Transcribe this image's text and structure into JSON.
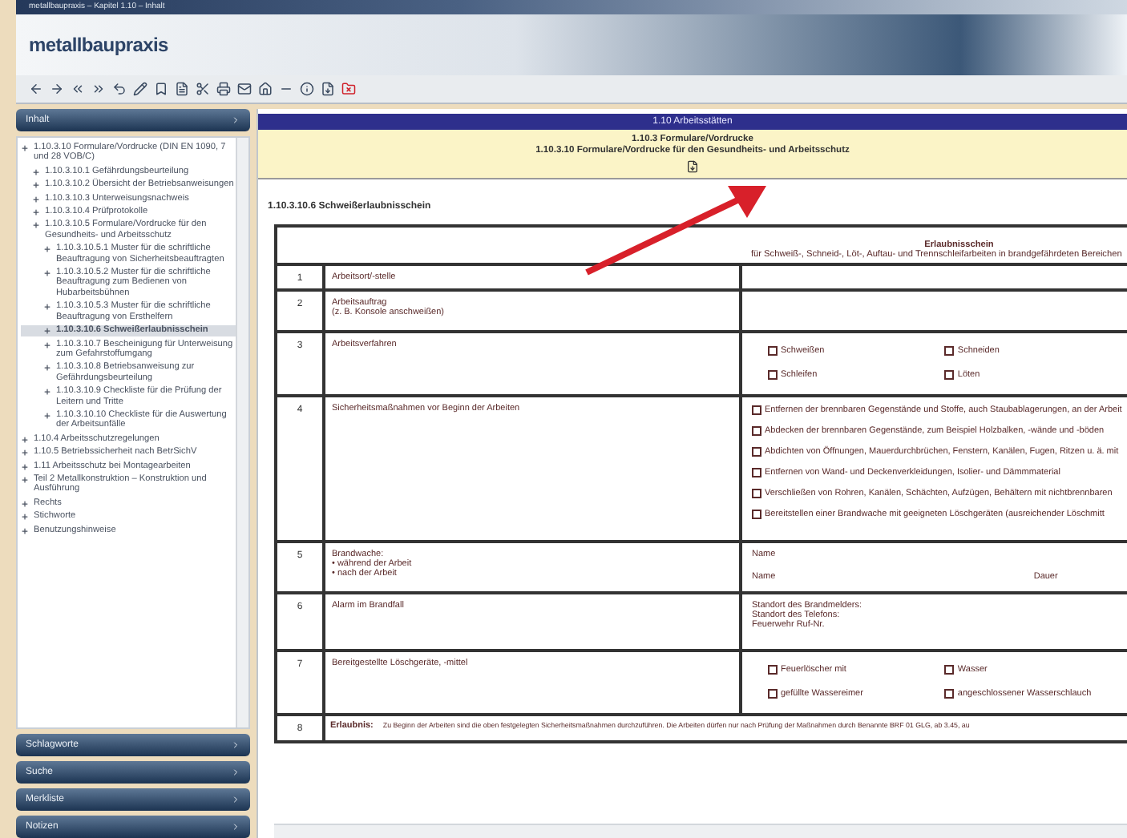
{
  "window": {
    "title": "metallbaupraxis – Kapitel 1.10 – Inhalt"
  },
  "app": {
    "logo": "metallbaupraxis"
  },
  "sidebar": {
    "header": "Inhalt",
    "tree": [
      {
        "label": "1.10.3.10 Formulare/Vordrucke (DIN EN 1090, 7 und 28 VOB/C)",
        "selected": false,
        "children": [
          {
            "label": "1.10.3.10.1 Gefährdungsbeurteilung",
            "selected": false
          },
          {
            "label": "1.10.3.10.2 Übersicht der Betriebsanweisungen",
            "selected": false
          },
          {
            "label": "1.10.3.10.3 Unterweisungsnachweis",
            "selected": false
          },
          {
            "label": "1.10.3.10.4 Prüfprotokolle",
            "selected": false
          },
          {
            "label": "1.10.3.10.5 Formulare/Vordrucke für den Gesundheits- und Arbeitsschutz",
            "selected": false,
            "children": [
              {
                "label": "1.10.3.10.5.1 Muster für die schriftliche Beauftragung von Sicherheitsbeauftragten",
                "selected": false
              },
              {
                "label": "1.10.3.10.5.2 Muster für die schriftliche Beauftragung zum Bedienen von Hubarbeitsbühnen",
                "selected": false
              },
              {
                "label": "1.10.3.10.5.3 Muster für die schriftliche Beauftragung von Ersthelfern",
                "selected": false
              },
              {
                "label": "1.10.3.10.6 Schweißerlaubnisschein",
                "selected": true
              },
              {
                "label": "1.10.3.10.7 Bescheinigung für Unterweisung zum Gefahrstoffumgang",
                "selected": false
              },
              {
                "label": "1.10.3.10.8 Betriebsanweisung zur Gefährdungsbeurteilung",
                "selected": false
              },
              {
                "label": "1.10.3.10.9 Checkliste für die Prüfung der Leitern und Tritte",
                "selected": false
              },
              {
                "label": "1.10.3.10.10 Checkliste für die Auswertung der Arbeitsunfälle",
                "selected": false
              }
            ]
          }
        ]
      },
      {
        "label": "1.10.4 Arbeitsschutzregelungen",
        "selected": false
      },
      {
        "label": "1.10.5 Betriebssicherheit nach BetrSichV",
        "selected": false
      },
      {
        "label": "1.11 Arbeitsschutz bei Montagearbeiten",
        "selected": false
      },
      {
        "label": "Teil 2 Metallkonstruktion – Konstruktion und Ausführung",
        "selected": false
      },
      {
        "label": "Rechts",
        "selected": false
      },
      {
        "label": "Stichworte",
        "selected": false
      },
      {
        "label": "Benutzungshinweise",
        "selected": false
      }
    ],
    "panels": [
      "Schlagworte",
      "Suche",
      "Merkliste",
      "Notizen"
    ]
  },
  "document": {
    "chapter": "1.10 Arbeitsstätten",
    "section": "1.10.3 Formulare/Vordrucke",
    "subsection": "1.10.3.10 Formulare/Vordrucke für den Gesundheits- und Arbeitsschutz",
    "heading": "1.10.3.10.6 Schweißerlaubnisschein",
    "form_title": "Erlaubnisschein",
    "form_subtitle": "für Schweiß-, Schneid-, Löt-, Auftau- und Trennschleifarbeiten in brandgefährdeten Bereichen",
    "rows": [
      {
        "number": "1",
        "label": [
          "Arbeitsort/-stelle"
        ],
        "kind": "blank"
      },
      {
        "number": "2",
        "label": [
          "Arbeitsauftrag",
          "(z. B. Konsole anschweißen)"
        ],
        "kind": "blank"
      },
      {
        "number": "3",
        "label": [
          "Arbeitsverfahren"
        ],
        "kind": "options",
        "options": [
          {
            "text": "Schweißen",
            "checked": false
          },
          {
            "text": "Schneiden",
            "checked": false
          },
          {
            "text": "Schleifen",
            "checked": false
          },
          {
            "text": "Löten",
            "checked": false
          }
        ]
      },
      {
        "number": "4",
        "label": [
          "Sicherheitsmaßnahmen vor Beginn der Arbeiten"
        ],
        "kind": "list",
        "options": [
          {
            "text": "Entfernen der brennbaren Gegenstände und Stoffe, auch Staubablagerungen, an der Arbeit",
            "checked": false
          },
          {
            "text": "Abdecken der brennbaren Gegenstände, zum Beispiel Holzbalken, -wände und -böden",
            "checked": false
          },
          {
            "text": "Abdichten von Öffnungen, Mauerdurchbrüchen, Fenstern, Kanälen, Fugen, Ritzen u. ä. mit",
            "checked": false
          },
          {
            "text": "Entfernen von Wand- und Deckenverkleidungen, Isolier- und Dämmmaterial",
            "checked": false
          },
          {
            "text": "Verschließen von Rohren, Kanälen, Schächten, Aufzügen, Behältern mit nichtbrennbaren",
            "checked": false
          },
          {
            "text": "Bereitstellen einer Brandwache mit geeigneten Löschgeräten (ausreichender Löschmitt",
            "checked": false
          }
        ]
      },
      {
        "number": "5",
        "label": [
          "Brandwache:",
          "• während der Arbeit",
          "• nach der Arbeit"
        ],
        "kind": "lines",
        "lines": [
          "Name",
          "Name",
          "Dauer"
        ]
      },
      {
        "number": "6",
        "label": [
          "Alarm im Brandfall"
        ],
        "kind": "text",
        "lines": [
          "Standort des Brandmelders:",
          "Standort des Telefons:",
          "Feuerwehr Ruf-Nr."
        ]
      },
      {
        "number": "7",
        "label": [
          "Bereitgestellte Löschgeräte, -mittel"
        ],
        "kind": "options",
        "options": [
          {
            "text": "Feuerlöscher mit",
            "checked": false
          },
          {
            "text": "Wasser",
            "checked": false
          },
          {
            "text": "gefüllte Wassereimer",
            "checked": false
          },
          {
            "text": "angeschlossener Wasserschlauch",
            "checked": false
          }
        ]
      },
      {
        "number": "8",
        "label": [
          "Erlaubnis:"
        ],
        "kind": "note",
        "note": "Zu Beginn der Arbeiten sind die oben festgelegten Sicherheitsmaßnahmen durchzuführen. Die Arbeiten dürfen nur nach Prüfung der Maßnahmen durch Benannte BRF 01 GLG, ab 3.45, au"
      }
    ]
  }
}
